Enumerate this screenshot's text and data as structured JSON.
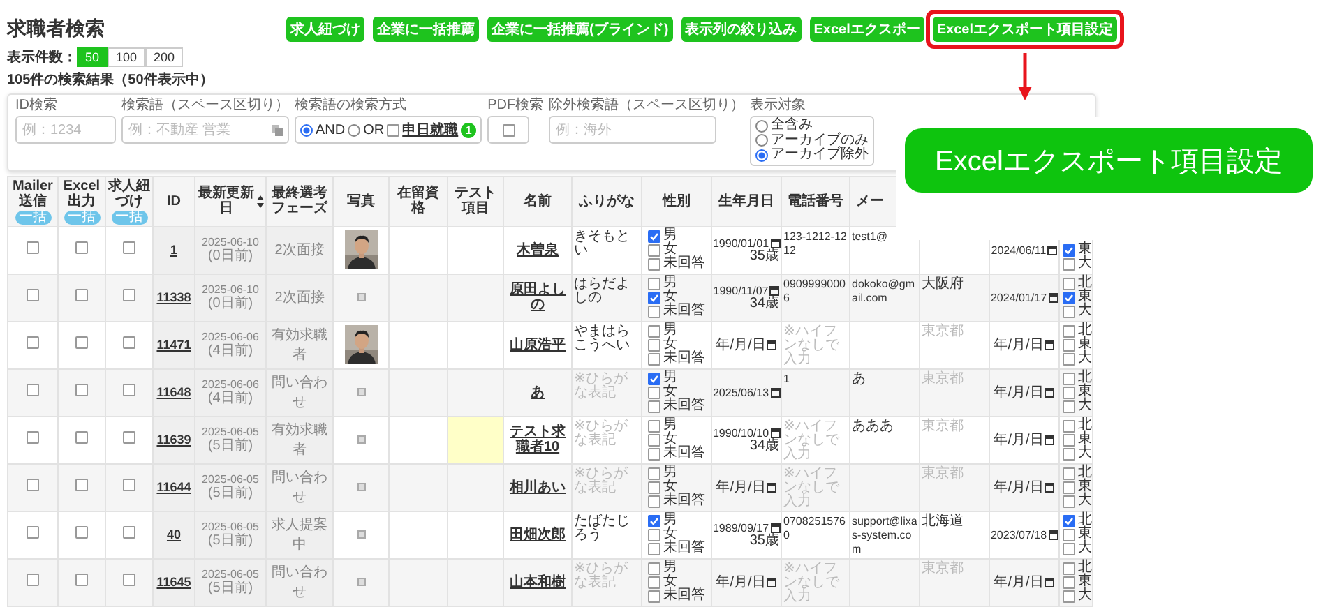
{
  "page_title": "求職者検索",
  "toolbar": [
    {
      "label": "求人紐づけ",
      "highlighted": false
    },
    {
      "label": "企業に一括推薦",
      "highlighted": false
    },
    {
      "label": "企業に一括推薦(ブラインド)",
      "highlighted": false
    },
    {
      "label": "表示列の絞り込み",
      "highlighted": false
    },
    {
      "label": "Excelエクスポー",
      "highlighted": false
    },
    {
      "label": "Excelエクスポート項目設定",
      "highlighted": true
    }
  ],
  "page_size": {
    "label": "表示件数：",
    "options": [
      {
        "label": "50",
        "selected": true
      },
      {
        "label": "100",
        "selected": false
      },
      {
        "label": "200",
        "selected": false
      }
    ]
  },
  "result_summary": "105件の検索結果（50件表示中）",
  "search": {
    "id_field": {
      "label": "ID検索",
      "placeholder": "例：1234"
    },
    "keyword_field": {
      "label": "検索語（スペース区切り）",
      "placeholder": "例：不動産 営業"
    },
    "method": {
      "label": "検索語の検索方式",
      "options": [
        {
          "label": "AND",
          "selected": true
        },
        {
          "label": "OR",
          "selected": false
        }
      ],
      "extra": {
        "label": "申日就職",
        "checked": false,
        "badge": "1"
      }
    },
    "pdf": {
      "label": "PDF検索",
      "checked": false
    },
    "exclude_field": {
      "label": "除外検索語（スペース区切り）",
      "placeholder": "例：海外"
    },
    "target": {
      "label": "表示対象",
      "options": [
        {
          "label": "全含み",
          "selected": false
        },
        {
          "label": "アーカイブのみ",
          "selected": false
        },
        {
          "label": "アーカイブ除外",
          "selected": true
        }
      ]
    }
  },
  "table": {
    "columns": [
      {
        "label": "Mailer送信",
        "pill": "一括",
        "sortable": false
      },
      {
        "label": "Excel出力",
        "pill": "一括",
        "sortable": false
      },
      {
        "label": "求人紐づけ",
        "pill": "一括",
        "sortable": false
      },
      {
        "label": "ID",
        "sortable": false
      },
      {
        "label": "最新更新日",
        "sortable": true
      },
      {
        "label": "最終選考フェーズ",
        "sortable": false
      },
      {
        "label": "写真",
        "sortable": false
      },
      {
        "label": "在留資格",
        "sortable": false
      },
      {
        "label": "テスト項目",
        "sortable": false
      },
      {
        "label": "名前",
        "sortable": false
      },
      {
        "label": "ふりがな",
        "sortable": false
      },
      {
        "label": "性別",
        "sortable": false
      },
      {
        "label": "生年月日",
        "sortable": false
      },
      {
        "label": "電話番号",
        "sortable": false
      },
      {
        "label": "メー",
        "sortable": false
      }
    ],
    "rows": [
      {
        "mailer": false,
        "excel": false,
        "job_link": false,
        "id": "1",
        "updated": "2025-06-10",
        "ago": "(0日前)",
        "phase": "2次面接",
        "photo": true,
        "test_flagged": false,
        "name": "木曽泉",
        "furigana": "きそもとい",
        "gender": [
          {
            "label": "男",
            "checked": true
          },
          {
            "label": "女",
            "checked": false
          },
          {
            "label": "未回答",
            "checked": false
          }
        ],
        "birth": "1990/01/01",
        "age": "35歳",
        "phone": "123-1212-1212",
        "email": "test1@",
        "column_17": "2024/06/11",
        "column_18": [
          {
            "label": "東",
            "checked": true
          },
          {
            "label": "大",
            "checked": false
          }
        ]
      },
      {
        "mailer": false,
        "excel": false,
        "job_link": false,
        "id": "11338",
        "updated": "2025-06-10",
        "ago": "(0日前)",
        "phase": "2次面接",
        "photo": false,
        "test_flagged": false,
        "name": "原田よしの",
        "furigana": "はらだよしの",
        "gender": [
          {
            "label": "男",
            "checked": false
          },
          {
            "label": "女",
            "checked": true
          },
          {
            "label": "未回答",
            "checked": false
          }
        ],
        "birth": "1990/11/07",
        "age": "34歳",
        "phone": "09099990006",
        "email": "dokoko@gmail.com",
        "address": "大阪府",
        "column_17": "2024/01/17",
        "column_18": [
          {
            "label": "北",
            "checked": false
          },
          {
            "label": "東",
            "checked": true
          },
          {
            "label": "大",
            "checked": false
          }
        ]
      },
      {
        "mailer": false,
        "excel": false,
        "job_link": false,
        "id": "11471",
        "updated": "2025-06-06",
        "ago": "(4日前)",
        "phase": "有効求職者",
        "photo": true,
        "test_flagged": false,
        "name": "山原浩平",
        "furigana": "やまはらこうへい",
        "gender": [
          {
            "label": "男",
            "checked": false
          },
          {
            "label": "女",
            "checked": false
          },
          {
            "label": "未回答",
            "checked": false
          }
        ],
        "birth_placeholder": "年/月/日",
        "phone_placeholder": "※ハイフンなしで入力",
        "address_placeholder": "東京都",
        "column_17_placeholder": "年/月/日",
        "column_18": [
          {
            "label": "北",
            "checked": false
          },
          {
            "label": "東",
            "checked": false
          },
          {
            "label": "大",
            "checked": false
          }
        ]
      },
      {
        "mailer": false,
        "excel": false,
        "job_link": false,
        "id": "11648",
        "updated": "2025-06-06",
        "ago": "(4日前)",
        "phase": "問い合わせ",
        "photo": false,
        "test_flagged": false,
        "name": "あ",
        "furigana_placeholder": "※ひらがな表記",
        "gender": [
          {
            "label": "男",
            "checked": true
          },
          {
            "label": "女",
            "checked": false
          },
          {
            "label": "未回答",
            "checked": false
          }
        ],
        "birth": "2025/06/13",
        "phone": "1",
        "email": "あ",
        "address_placeholder": "東京都",
        "column_17_placeholder": "年/月/日",
        "column_18": [
          {
            "label": "北",
            "checked": false
          },
          {
            "label": "東",
            "checked": false
          },
          {
            "label": "大",
            "checked": false
          }
        ]
      },
      {
        "mailer": false,
        "excel": false,
        "job_link": false,
        "id": "11639",
        "updated": "2025-06-05",
        "ago": "(5日前)",
        "phase": "有効求職者",
        "photo": false,
        "test_flagged": true,
        "name": "テスト求職者10",
        "furigana_placeholder": "※ひらがな表記",
        "gender": [
          {
            "label": "男",
            "checked": false
          },
          {
            "label": "女",
            "checked": false
          },
          {
            "label": "未回答",
            "checked": false
          }
        ],
        "birth": "1990/10/10",
        "age": "34歳",
        "phone_placeholder": "※ハイフンなしで入力",
        "email": "あああ",
        "address_placeholder": "東京都",
        "column_17_placeholder": "年/月/日",
        "column_18": [
          {
            "label": "北",
            "checked": false
          },
          {
            "label": "東",
            "checked": false
          },
          {
            "label": "大",
            "checked": false
          }
        ]
      },
      {
        "mailer": false,
        "excel": false,
        "job_link": false,
        "id": "11644",
        "updated": "2025-06-05",
        "ago": "(5日前)",
        "phase": "問い合わせ",
        "photo": false,
        "test_flagged": false,
        "name": "相川あい",
        "furigana_placeholder": "※ひらがな表記",
        "gender": [
          {
            "label": "男",
            "checked": false
          },
          {
            "label": "女",
            "checked": false
          },
          {
            "label": "未回答",
            "checked": false
          }
        ],
        "birth_placeholder": "年/月/日",
        "phone_placeholder": "※ハイフンなしで入力",
        "address_placeholder": "東京都",
        "column_17_placeholder": "年/月/日",
        "column_18": [
          {
            "label": "北",
            "checked": false
          },
          {
            "label": "東",
            "checked": false
          },
          {
            "label": "大",
            "checked": false
          }
        ]
      },
      {
        "mailer": false,
        "excel": false,
        "job_link": false,
        "id": "40",
        "updated": "2025-06-05",
        "ago": "(5日前)",
        "phase": "求人提案中",
        "photo": false,
        "test_flagged": false,
        "name": "田畑次郎",
        "furigana": "たばたじろう",
        "gender": [
          {
            "label": "男",
            "checked": true
          },
          {
            "label": "女",
            "checked": false
          },
          {
            "label": "未回答",
            "checked": false
          }
        ],
        "birth": "1989/09/17",
        "age": "35歳",
        "phone": "07082515760",
        "email": "support@lixas-system.com",
        "address": "北海道",
        "column_17": "2023/07/18",
        "column_18": [
          {
            "label": "北",
            "checked": true
          },
          {
            "label": "東",
            "checked": false
          },
          {
            "label": "大",
            "checked": false
          }
        ]
      },
      {
        "mailer": false,
        "excel": false,
        "job_link": false,
        "id": "11645",
        "updated": "2025-06-05",
        "ago": "(5日前)",
        "phase": "問い合わせ",
        "photo": false,
        "test_flagged": false,
        "name": "山本和樹",
        "furigana_placeholder": "※ひらがな表記",
        "gender": [
          {
            "label": "男",
            "checked": false
          },
          {
            "label": "女",
            "checked": false
          },
          {
            "label": "未回答",
            "checked": false
          }
        ],
        "birth_placeholder": "年/月/日",
        "phone_placeholder": "※ハイフンなしで入力",
        "address_placeholder": "東京都",
        "column_17_placeholder": "年/月/日",
        "column_18": [
          {
            "label": "北",
            "checked": false
          },
          {
            "label": "東",
            "checked": false
          },
          {
            "label": "大",
            "checked": false
          }
        ]
      }
    ]
  },
  "callout": {
    "label": "Excelエクスポート項目設定"
  }
}
